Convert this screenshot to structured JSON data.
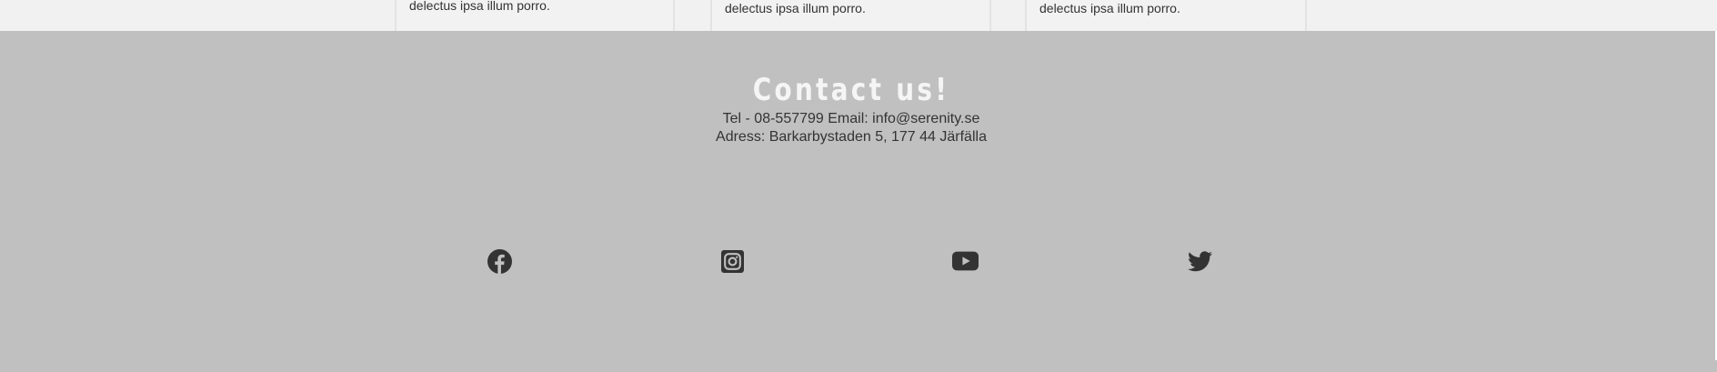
{
  "cards": [
    {
      "text": "delectus ipsa illum porro."
    },
    {
      "text": "delectus ipsa illum porro."
    },
    {
      "text": "delectus ipsa illum porro."
    }
  ],
  "footer": {
    "title": "Contact us!",
    "contact_line": "Tel - 08-557799 Email: info@serenity.se",
    "address_line": "Adress: Barkarbystaden 5, 177 44 Järfälla",
    "social": [
      {
        "icon": "facebook-icon"
      },
      {
        "icon": "instagram-icon"
      },
      {
        "icon": "youtube-icon"
      },
      {
        "icon": "twitter-icon"
      }
    ]
  },
  "colors": {
    "footer_background": "#c0c0c0",
    "title_color": "#f5f5f5",
    "text_color": "#333333",
    "icon_color": "#333333",
    "card_background": "#f2f2f2"
  }
}
